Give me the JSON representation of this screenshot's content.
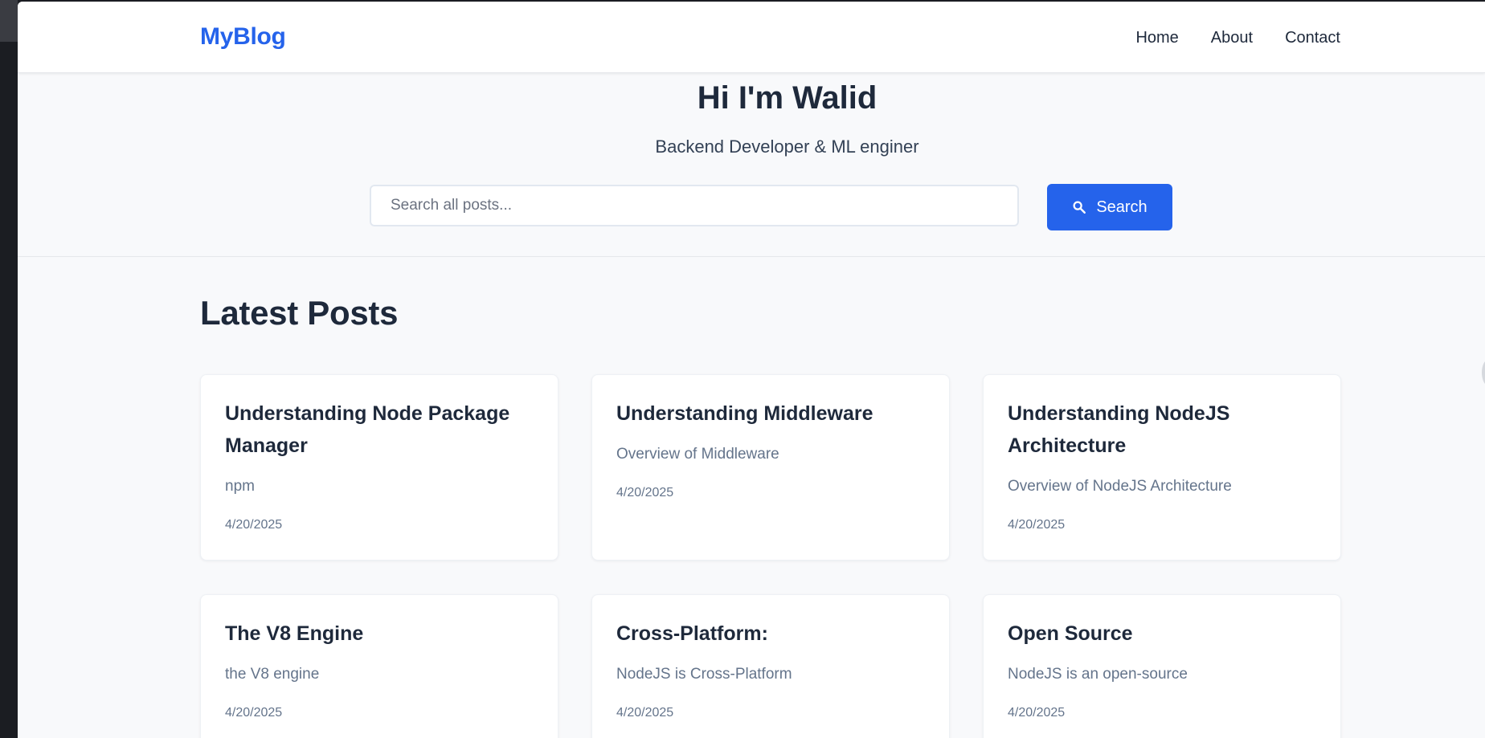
{
  "brand": "MyBlog",
  "nav": [
    {
      "label": "Home"
    },
    {
      "label": "About"
    },
    {
      "label": "Contact"
    }
  ],
  "hero": {
    "title": "Hi I'm Walid",
    "subtitle": "Backend Developer & ML enginer"
  },
  "search": {
    "placeholder": "Search all posts...",
    "button_label": "Search",
    "icon": "search-icon"
  },
  "posts_section": {
    "title": "Latest Posts"
  },
  "posts": [
    {
      "title": "Understanding Node Package Manager",
      "description": "npm",
      "date": "4/20/2025"
    },
    {
      "title": "Understanding Middleware",
      "description": "Overview of Middleware",
      "date": "4/20/2025"
    },
    {
      "title": "Understanding NodeJS Architecture",
      "description": "Overview of NodeJS Architecture",
      "date": "4/20/2025"
    },
    {
      "title": "The V8 Engine",
      "description": "the V8 engine",
      "date": "4/20/2025"
    },
    {
      "title": "Cross-Platform:",
      "description": "NodeJS is Cross-Platform",
      "date": "4/20/2025"
    },
    {
      "title": "Open Source",
      "description": "NodeJS is an open-source",
      "date": "4/20/2025"
    }
  ],
  "colors": {
    "accent": "#2563eb",
    "text": "#1e293b",
    "muted": "#64748b",
    "background": "#f8f9fb"
  }
}
